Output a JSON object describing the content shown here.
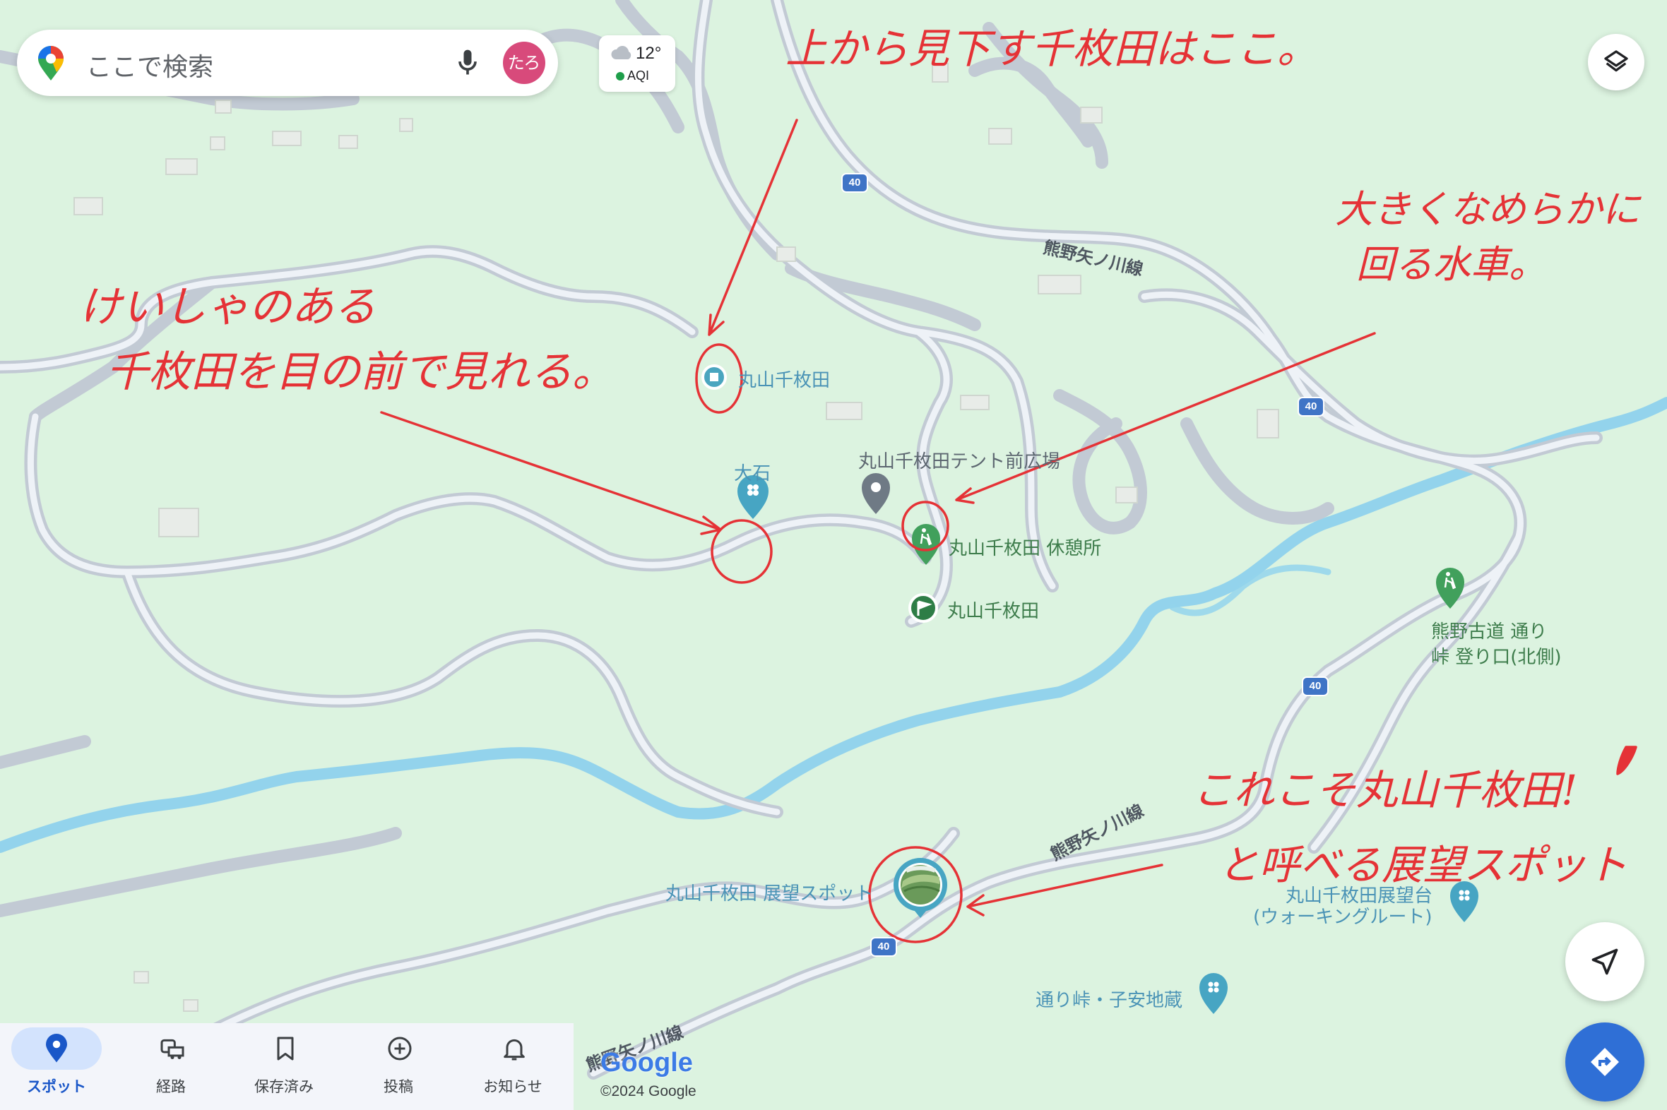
{
  "search": {
    "placeholder": "ここで検索",
    "avatar_text": "たろ"
  },
  "weather": {
    "temperature": "12°",
    "aqi_label": "AQI"
  },
  "route_number": "40",
  "places": {
    "maruyama_senmaida_top": "丸山千枚田",
    "oishi": "大石",
    "tent_plaza": "丸山千枚田テント前広場",
    "rest_area": "丸山千枚田 休憩所",
    "maruyama_senmaida_flag": "丸山千枚田",
    "kumano_kodo_line1": "熊野古道 通り",
    "kumano_kodo_line2": "峠 登り口(北側)",
    "viewpoint": "丸山千枚田 展望スポット",
    "observatory_line1": "丸山千枚田展望台",
    "observatory_line2": "(ウォーキングルート)",
    "torizaka_jizo": "通り峠・子安地蔵"
  },
  "roads": {
    "upper": "熊野矢ノ川線",
    "middle": "熊野矢ノ川線",
    "lower": "熊野矢ノ川線"
  },
  "annotations": {
    "top": "上から見下す千枚田はここ。",
    "right_line1": "大きくなめらかに",
    "right_line2": "回る水車。",
    "left_line1": "けいしゃのある",
    "left_line2": "千枚田を目の前で見れる。",
    "bottom_line1": "これこそ丸山千枚田!",
    "bottom_line2": "と呼べる展望スポット"
  },
  "attribution": {
    "logo": "Google",
    "copyright": "©2024 Google"
  },
  "nav": [
    {
      "label": "スポット",
      "active": true
    },
    {
      "label": "経路"
    },
    {
      "label": "保存済み"
    },
    {
      "label": "投稿"
    },
    {
      "label": "お知らせ"
    }
  ],
  "colors": {
    "map_bg": "#dcf3e0",
    "road": "#c4ccd6",
    "river": "#8fd4ee",
    "annotation": "#e53236",
    "accent": "#1a73e8"
  }
}
